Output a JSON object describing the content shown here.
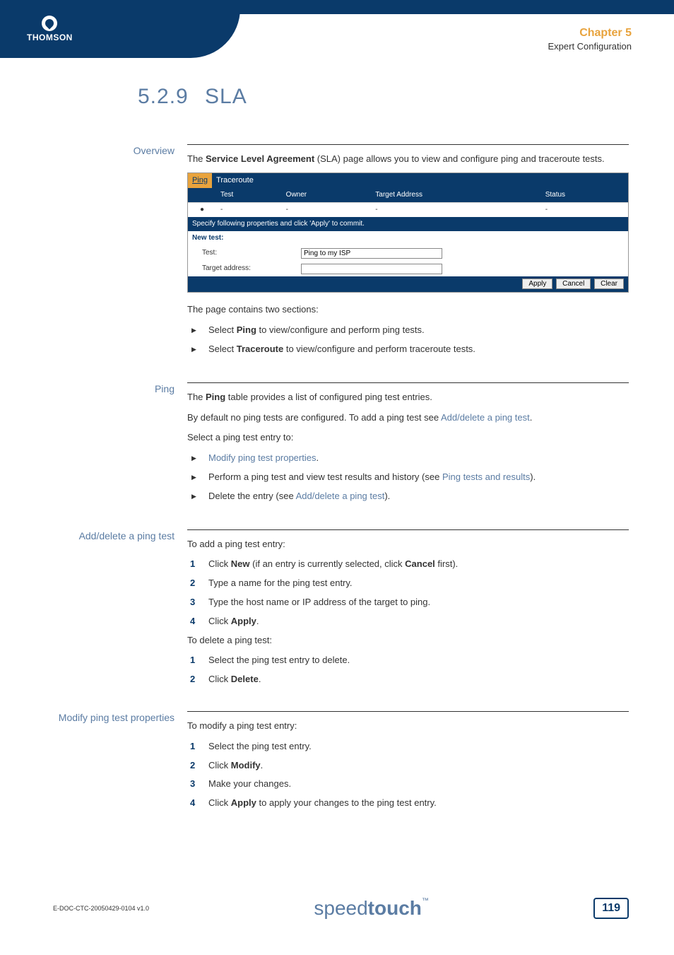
{
  "header": {
    "logo_text": "THOMSON",
    "chapter_title": "Chapter 5",
    "chapter_subtitle": "Expert Configuration"
  },
  "page": {
    "section_num": "5.2.9",
    "section_title": "SLA"
  },
  "overview": {
    "label": "Overview",
    "intro_pre": "The ",
    "intro_bold": "Service Level Agreement",
    "intro_post": " (SLA) page allows you to view and configure ping and traceroute tests.",
    "tabs": {
      "active": "Ping",
      "other": "Traceroute"
    },
    "table": {
      "headers": [
        "",
        "Test",
        "Owner",
        "Target Address",
        "Status"
      ],
      "row": [
        "",
        "-",
        "-",
        "-",
        "-"
      ]
    },
    "instr": "Specify following properties and click 'Apply' to commit.",
    "newtest": "New test:",
    "form": {
      "test_label": "Test:",
      "test_value": "Ping to my ISP",
      "target_label": "Target address:",
      "target_value": ""
    },
    "buttons": {
      "apply": "Apply",
      "cancel": "Cancel",
      "clear": "Clear"
    },
    "after1": "The page contains two sections:",
    "bullets": [
      {
        "pre": "Select ",
        "bold": "Ping",
        "post": " to view/configure and perform ping tests."
      },
      {
        "pre": "Select ",
        "bold": "Traceroute",
        "post": " to view/configure and perform traceroute tests."
      }
    ]
  },
  "ping": {
    "label": "Ping",
    "p1_pre": "The ",
    "p1_bold": "Ping",
    "p1_post": " table provides a list of configured ping test entries.",
    "p2_pre": "By default no ping tests are configured. To add a ping test see ",
    "p2_link": "Add/delete a ping test",
    "p2_post": ".",
    "p3": "Select a ping test entry to:",
    "bullets": [
      {
        "link": "Modify ping test properties",
        "post": "."
      },
      {
        "pre": "Perform a ping test and view test results and history (see ",
        "link": "Ping tests and results",
        "post": ")."
      },
      {
        "pre": "Delete the entry (see ",
        "link": "Add/delete a ping test",
        "post": ")."
      }
    ]
  },
  "adddelete": {
    "label": "Add/delete a ping test",
    "intro1": "To add a ping test entry:",
    "steps_add": [
      {
        "pre": "Click ",
        "bold": "New",
        "mid": " (if an entry is currently selected, click ",
        "bold2": "Cancel",
        "post": " first)."
      },
      {
        "text": "Type a name for the ping test entry."
      },
      {
        "text": "Type the host name or IP address of the target to ping."
      },
      {
        "pre": "Click ",
        "bold": "Apply",
        "post": "."
      }
    ],
    "intro2": "To delete a ping test:",
    "steps_del": [
      {
        "text": "Select the ping test entry to delete."
      },
      {
        "pre": "Click ",
        "bold": "Delete",
        "post": "."
      }
    ]
  },
  "modify": {
    "label": "Modify ping test properties",
    "intro": "To modify a ping test entry:",
    "steps": [
      {
        "text": "Select the ping test entry."
      },
      {
        "pre": "Click ",
        "bold": "Modify",
        "post": "."
      },
      {
        "text": "Make your changes."
      },
      {
        "pre": "Click ",
        "bold": "Apply",
        "post": " to apply your changes to the ping test entry."
      }
    ]
  },
  "footer": {
    "docid": "E-DOC-CTC-20050429-0104 v1.0",
    "brand_light": "speed",
    "brand_bold": "touch",
    "brand_tm": "™",
    "pagenum": "119"
  }
}
